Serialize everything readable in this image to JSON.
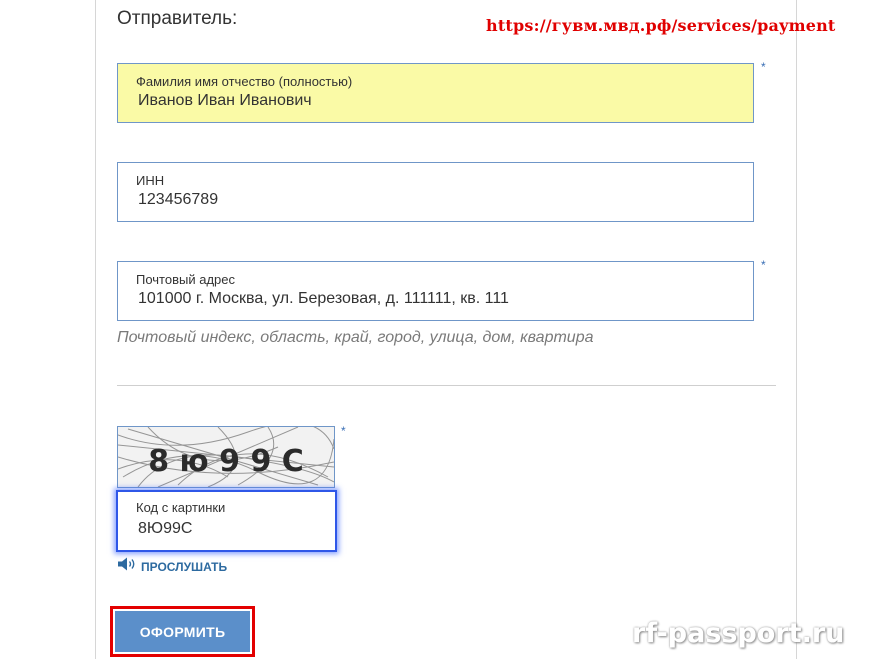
{
  "section_title": "Отправитель:",
  "url_overlay": "https://гувм.мвд.рф/services/payment",
  "required_mark": "*",
  "fields": {
    "full_name": {
      "label": "Фамилия имя отчество (полностью)",
      "value": "Иванов Иван Иванович"
    },
    "inn": {
      "label": "ИНН",
      "value": "123456789"
    },
    "address": {
      "label": "Почтовый адрес",
      "value": "101000 г. Москва, ул. Березовая, д. 111111, кв. 111",
      "hint": "Почтовый индекс, область, край, город, улица, дом, квартира"
    }
  },
  "captcha": {
    "image_text": "8 ю 9  9 C",
    "label": "Код с картинки",
    "value": "8Ю99С",
    "listen_label": "ПРОСЛУШАТЬ"
  },
  "submit_label": "ОФОРМИТЬ",
  "watermark": "rf-passport.ru",
  "colors": {
    "field_border": "#6f96c8",
    "highlight_bg": "#fafaa6",
    "focus_border": "#2f57e8",
    "button_bg": "#5b8fca",
    "annotation_red": "#e30000",
    "link_blue": "#2d6aa0"
  }
}
